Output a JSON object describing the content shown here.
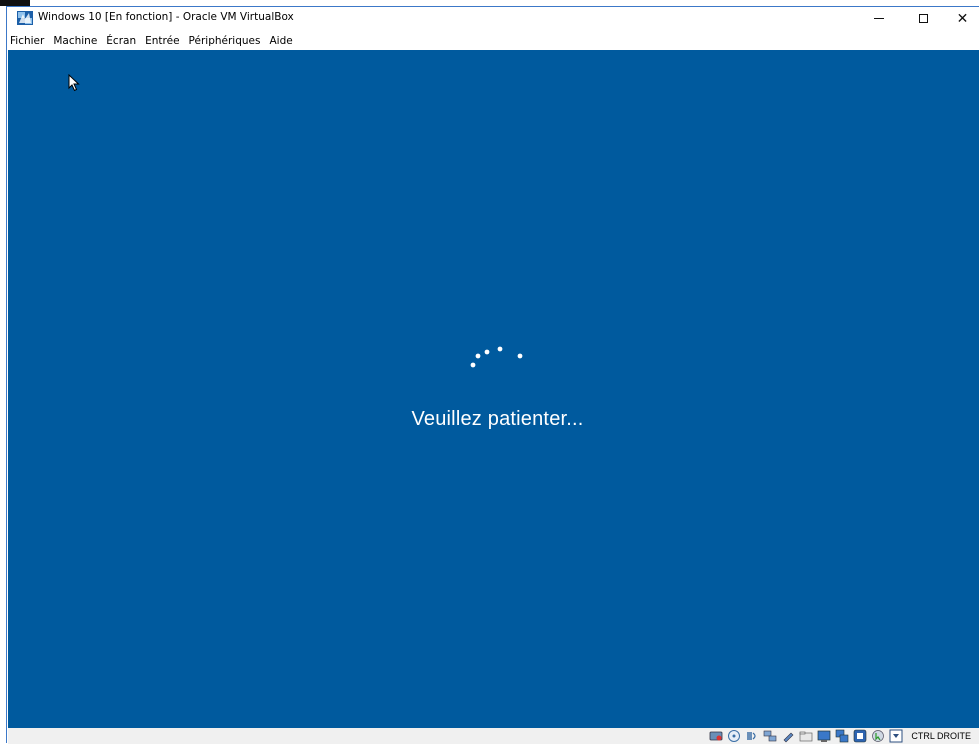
{
  "window": {
    "title": "Windows 10 [En fonction] - Oracle VM VirtualBox"
  },
  "menubar": {
    "items": [
      {
        "label": "Fichier"
      },
      {
        "label": "Machine"
      },
      {
        "label": "Écran"
      },
      {
        "label": "Entrée"
      },
      {
        "label": "Périphériques"
      },
      {
        "label": "Aide"
      }
    ]
  },
  "vm": {
    "background_color": "#005a9e",
    "status_message": "Veuillez patienter..."
  },
  "statusbar": {
    "icons": [
      "hard-disk-icon",
      "optical-drive-icon",
      "audio-icon",
      "network-icon",
      "usb-icon",
      "shared-folders-icon",
      "display-icon",
      "video-capture-icon",
      "virtualization-icon",
      "mouse-integration-icon",
      "keyboard-capture-icon"
    ],
    "host_key": "CTRL DROITE"
  },
  "colors": {
    "accent": "#3c78c8",
    "vm_screen": "#005a9e",
    "text_on_vm": "#ffffff"
  }
}
